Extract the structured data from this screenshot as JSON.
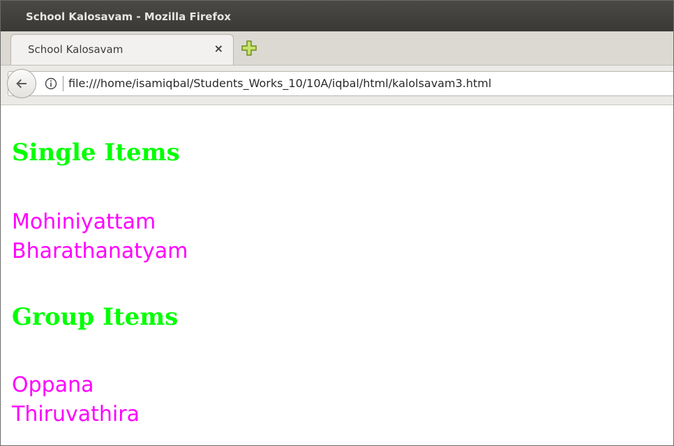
{
  "window": {
    "title": "School Kalosavam - Mozilla Firefox"
  },
  "tabs": [
    {
      "label": "School Kalosavam",
      "close": "×"
    }
  ],
  "navbar": {
    "url": "file:///home/isamiqbal/Students_Works_10/10A/iqbal/html/kalolsavam3.html"
  },
  "page": {
    "sections": [
      {
        "heading": "Single Items",
        "items": [
          "Mohiniyattam",
          "Bharathanatyam"
        ]
      },
      {
        "heading": "Group Items",
        "items": [
          "Oppana",
          "Thiruvathira"
        ]
      }
    ]
  },
  "colors": {
    "heading": "#00ff00",
    "item": "#ff00ff"
  },
  "icons": {
    "back": "back-arrow-icon",
    "info": "info-icon",
    "new_tab": "new-tab-plus-icon"
  }
}
